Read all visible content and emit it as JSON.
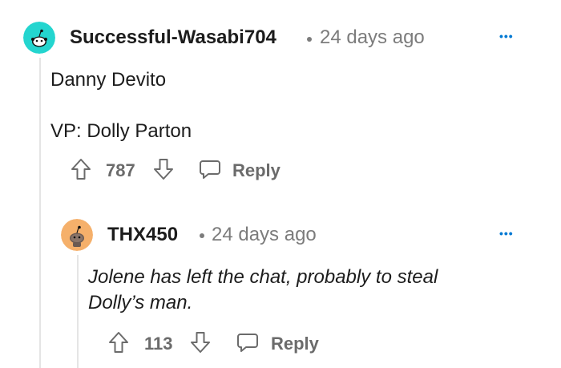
{
  "comments": [
    {
      "username": "Successful-Wasabi704",
      "age": "24 days ago",
      "more_label": "•••",
      "body": [
        "Danny Devito",
        "VP: Dolly Parton"
      ],
      "score": "787",
      "reply_label": "Reply",
      "avatar_color": "#24d5cf"
    },
    {
      "username": "THX450",
      "age": "24 days ago",
      "more_label": "•••",
      "body": [
        "Jolene has left the chat, probably to steal Dolly’s man."
      ],
      "score": "113",
      "reply_label": "Reply",
      "avatar_color": "#f5b06b"
    }
  ],
  "icons": {
    "upvote": "arrow-up-outline-icon",
    "downvote": "arrow-down-outline-icon",
    "reply": "speech-bubble-icon",
    "more": "overflow-dots-icon"
  }
}
